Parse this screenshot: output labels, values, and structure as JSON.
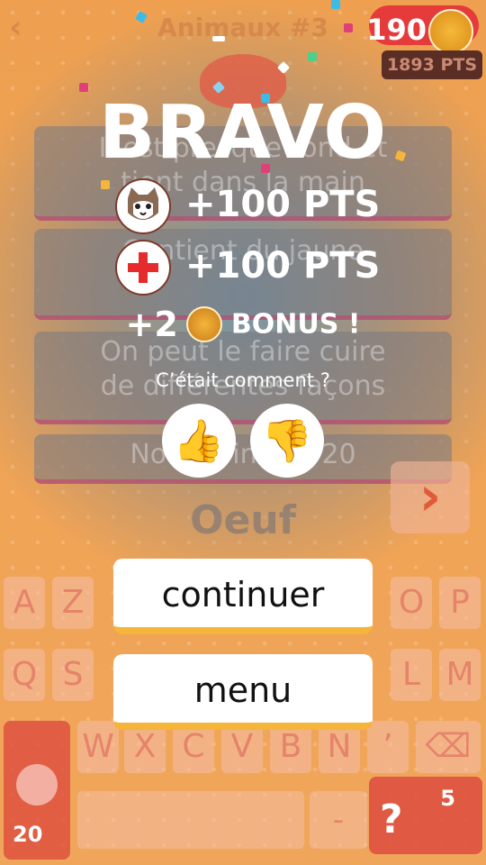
{
  "header": {
    "back_icon": "chevron-left-icon",
    "level_title": "Animaux #3",
    "coins": "190",
    "points": "1893 PTS"
  },
  "clues": [
    "Il est presque rond et\ntient dans la main",
    "Contient du jaune",
    "On peut le faire cuire\nde différentes façons",
    "Nouvel indice 20"
  ],
  "answer": "Oeuf",
  "keyboard": {
    "row1": [
      "A",
      "Z",
      "",
      "",
      "",
      "",
      "",
      "",
      "O",
      "P"
    ],
    "row2": [
      "Q",
      "S",
      "",
      "",
      "",
      "",
      "",
      "",
      "L",
      "M"
    ],
    "row3": [
      "W",
      "X",
      "C",
      "V",
      "B",
      "N",
      "’"
    ],
    "bomb_cost": "20",
    "dash": "-",
    "hint_symbol": "?",
    "hint_cost": "5"
  },
  "overlay": {
    "title": "BRAVO",
    "rewards": [
      {
        "icon": "cat-avatar-icon",
        "text": "+100 PTS"
      },
      {
        "icon": "red-cross-icon",
        "text": "+100 PTS"
      }
    ],
    "bonus_amount": "+2",
    "bonus_label": "BONUS !",
    "question": "C’était comment ?",
    "thumb_up": "👍",
    "thumb_down": "👎",
    "continue_label": "continuer",
    "menu_label": "menu"
  }
}
